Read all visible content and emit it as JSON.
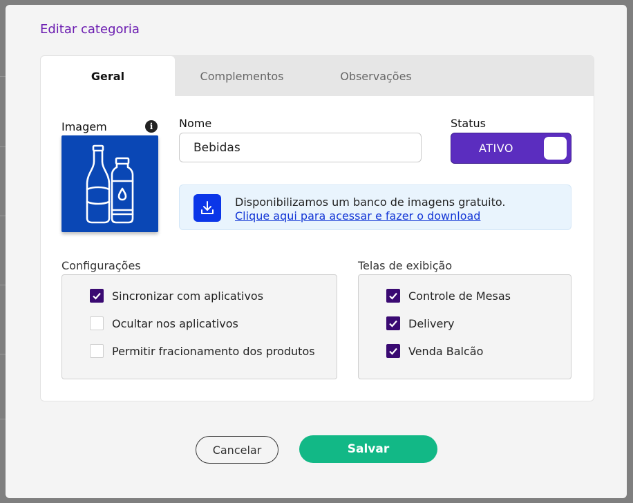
{
  "modal": {
    "title": "Editar categoria"
  },
  "tabs": [
    {
      "label": "Geral",
      "active": true
    },
    {
      "label": "Complementos",
      "active": false
    },
    {
      "label": "Observações",
      "active": false
    }
  ],
  "image": {
    "label": "Imagem",
    "info_icon": "info-icon",
    "illustration": "bottles-icon",
    "background_color": "#0a47b5"
  },
  "name": {
    "label": "Nome",
    "value": "Bebidas"
  },
  "status": {
    "label": "Status",
    "value": "ATIVO",
    "color": "#5b2dbf"
  },
  "banner": {
    "icon": "download-icon",
    "text": "Disponibilizamos um banco de imagens gratuito.",
    "link": "Clique aqui para acessar e fazer o download"
  },
  "config": {
    "title": "Configurações",
    "options": [
      {
        "label": "Sincronizar com aplicativos",
        "checked": true
      },
      {
        "label": "Ocultar nos aplicativos",
        "checked": false
      },
      {
        "label": "Permitir fracionamento dos produtos",
        "checked": false
      }
    ]
  },
  "screens": {
    "title": "Telas de exibição",
    "options": [
      {
        "label": "Controle de Mesas",
        "checked": true
      },
      {
        "label": "Delivery",
        "checked": true
      },
      {
        "label": "Venda Balcão",
        "checked": true
      }
    ]
  },
  "actions": {
    "cancel": "Cancelar",
    "save": "Salvar",
    "save_color": "#12b886"
  }
}
